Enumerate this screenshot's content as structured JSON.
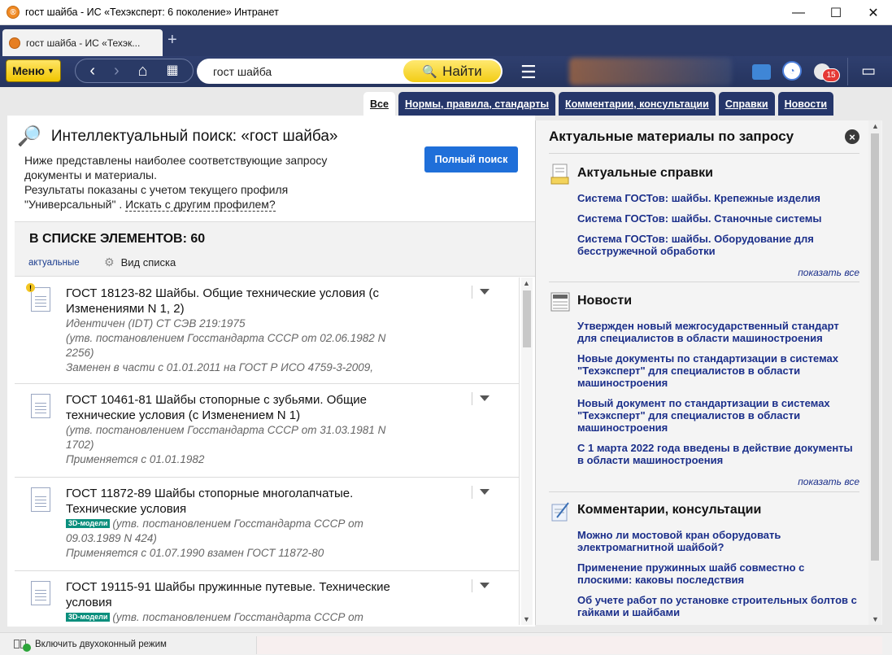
{
  "window": {
    "title": "гост шайба - ИС «Техэксперт: 6 поколение» Интранет",
    "controls": [
      "—",
      "☐",
      "✕"
    ]
  },
  "browser_tab": {
    "label": "гост шайба - ИС «Техэк...",
    "new_tab": "+"
  },
  "toolbar": {
    "menu_label": "Меню",
    "search_value": "гост шайба",
    "find_label": "Найти",
    "notification_count": "15"
  },
  "category_tabs": [
    {
      "label": "Все",
      "active": true
    },
    {
      "label": "Нормы, правила, стандарты",
      "active": false
    },
    {
      "label": "Комментарии, консультации",
      "active": false
    },
    {
      "label": "Справки",
      "active": false
    },
    {
      "label": "Новости",
      "active": false
    }
  ],
  "search": {
    "heading": "Интеллектуальный поиск: «гост шайба»",
    "desc_line1": "Ниже представлены наиболее соответствующие запросу документы и материалы.",
    "desc_line2": "Результаты показаны с учетом текущего профиля",
    "desc_profile": "\"Универсальный\" .",
    "desc_link": "Искать с другим профилем?",
    "full_search": "Полный поиск"
  },
  "list": {
    "count_label": "В СПИСКЕ ЭЛЕМЕНТОВ: 60",
    "filter": "актуальные",
    "view": "Вид списка",
    "items": [
      {
        "title": "ГОСТ 18123-82 Шайбы. Общие технические условия (с Изменениями N 1, 2)",
        "meta1": "Идентичен (IDT) СТ СЭВ 219:1975",
        "meta2": "(утв. постановлением Госстандарта СССР от 02.06.1982 N 2256)",
        "meta3": "Заменен в части с 01.01.2011 на ГОСТ Р ИСО 4759-3-2009,",
        "tag": "",
        "warning": true
      },
      {
        "title": "ГОСТ 10461-81 Шайбы стопорные с зубьями. Общие технические условия (с Изменением N 1)",
        "meta1": "",
        "meta2": "(утв. постановлением Госстандарта СССР от 31.03.1981 N 1702)",
        "meta3": "Применяется с 01.01.1982",
        "tag": "",
        "warning": false
      },
      {
        "title": "ГОСТ 11872-89 Шайбы стопорные многолапчатые. Технические условия",
        "meta1": "",
        "meta2": "(утв. постановлением Госстандарта СССР от 09.03.1989 N 424)",
        "meta3": "Применяется с 01.07.1990 взамен ГОСТ 11872-80",
        "tag": "3D-модели",
        "warning": false
      },
      {
        "title": "ГОСТ 19115-91 Шайбы пружинные путевые. Технические условия",
        "meta1": "",
        "meta2": "(утв. постановлением Госстандарта СССР от",
        "meta3": "",
        "tag": "3D-модели",
        "warning": false
      }
    ]
  },
  "right_panel": {
    "title": "Актуальные материалы по запросу",
    "close": "×",
    "sections": [
      {
        "title": "Актуальные справки",
        "icon": "reference-icon",
        "links": [
          "Система ГОСТов: шайбы. Крепежные изделия",
          "Система ГОСТов: шайбы. Станочные системы",
          "Система ГОСТов: шайбы. Оборудование для бесстружечной обработки"
        ],
        "more": "показать все"
      },
      {
        "title": "Новости",
        "icon": "news-icon",
        "links": [
          "Утвержден новый межгосударственный стандарт для специалистов в области машиностроения",
          "Новые документы по стандартизации в системах \"Техэксперт\" для специалистов в области машиностроения",
          "Новый документ по стандартизации в системах \"Техэксперт\" для специалистов в области машиностроения",
          "С 1 марта 2022 года введены в действие документы в области машиностроения"
        ],
        "more": "показать все"
      },
      {
        "title": "Комментарии, консультации",
        "icon": "comment-icon",
        "links": [
          "Можно ли мостовой кран оборудовать электромагнитной шайбой?",
          "Применение пружинных шайб совместно с плоскими: каковы последствия",
          "Об учете работ по установке строительных болтов с гайками и шайбами"
        ],
        "more": ""
      }
    ]
  },
  "status": {
    "dual_mode": "Включить двухоконный режим"
  }
}
